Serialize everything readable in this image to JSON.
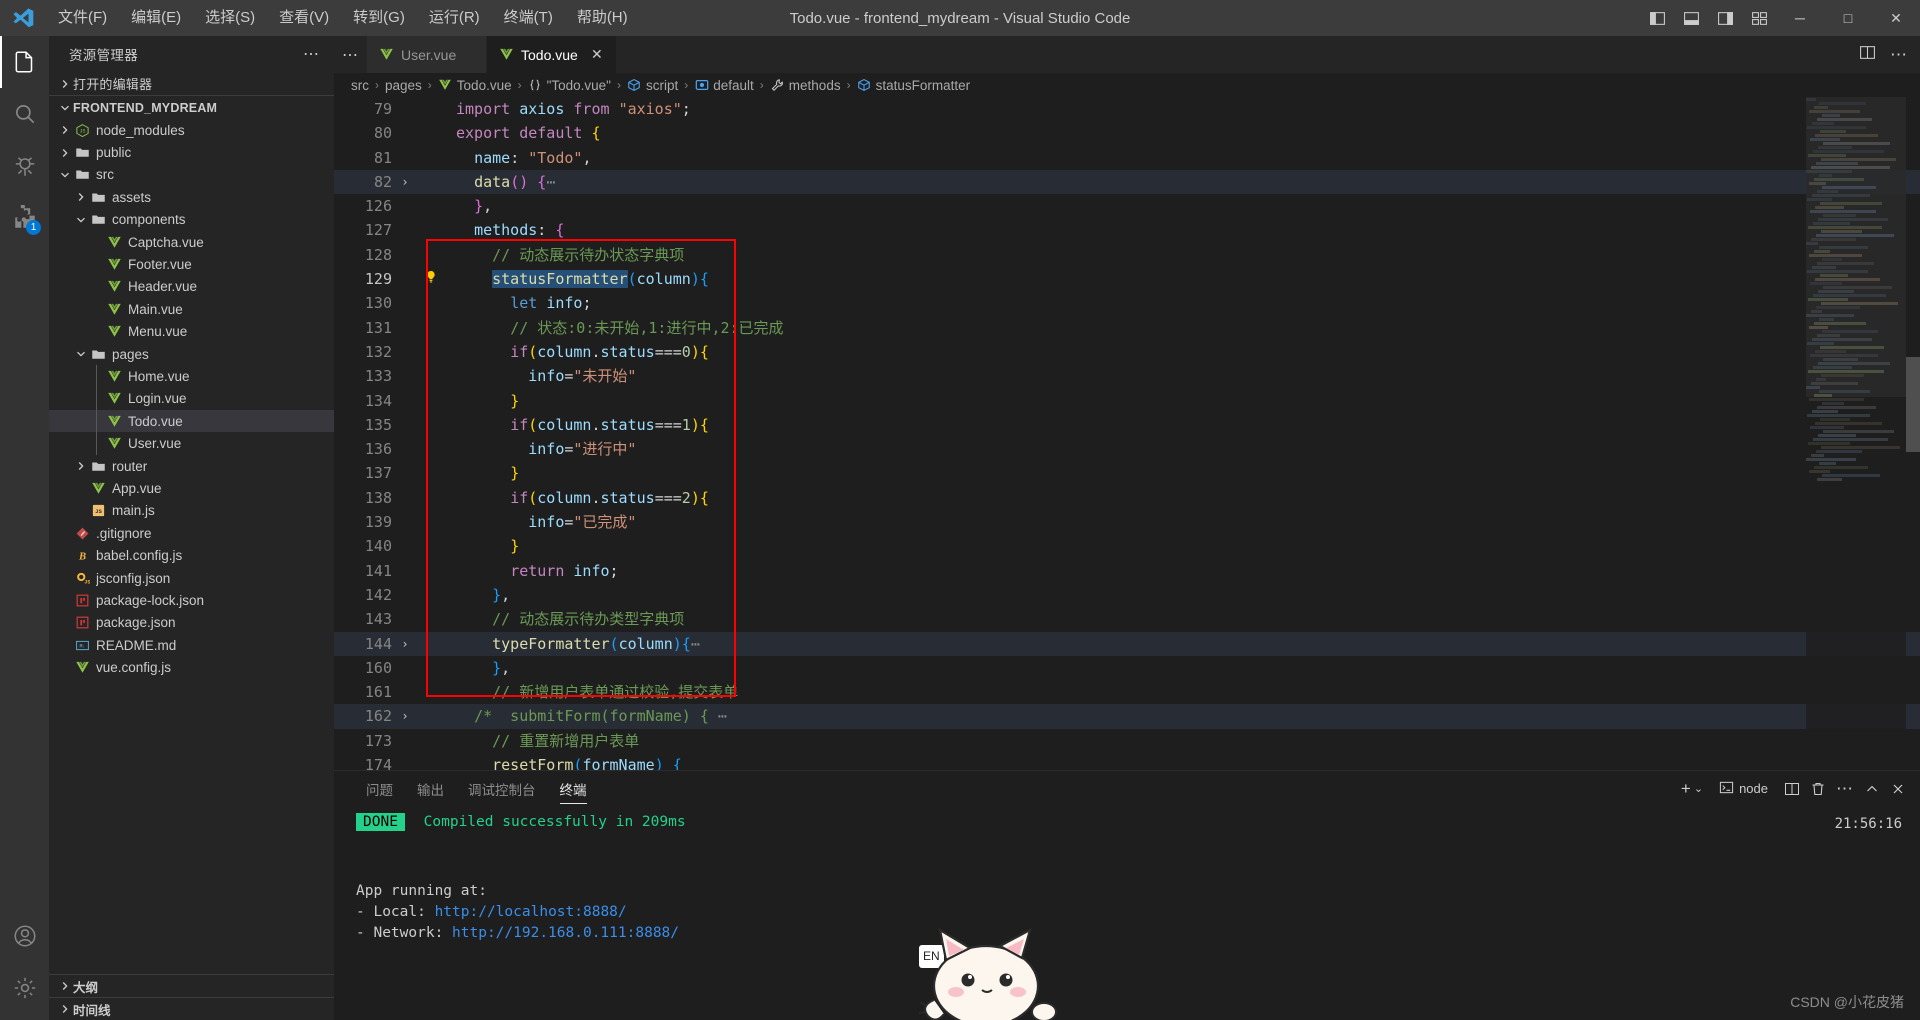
{
  "titlebar": {
    "logo_icon": "vscode-logo-icon",
    "menus": [
      "文件(F)",
      "编辑(E)",
      "选择(S)",
      "查看(V)",
      "转到(G)",
      "运行(R)",
      "终端(T)",
      "帮助(H)"
    ],
    "window_title": "Todo.vue - frontend_mydream - Visual Studio Code",
    "layout_buttons": [
      "toggle-primary-sidebar-icon",
      "toggle-panel-icon",
      "toggle-secondary-sidebar-icon",
      "customize-layout-icon"
    ],
    "minimize": "─",
    "maximize": "□",
    "close": "✕"
  },
  "activitybar": {
    "items": [
      {
        "name": "explorer",
        "icon": "files-icon",
        "active": true,
        "badge": ""
      },
      {
        "name": "search",
        "icon": "search-icon",
        "active": false,
        "badge": ""
      },
      {
        "name": "run-and-debug",
        "icon": "debug-icon",
        "active": false,
        "badge": ""
      },
      {
        "name": "extensions",
        "icon": "extensions-icon",
        "active": false,
        "badge": "1"
      }
    ],
    "bottom": [
      {
        "name": "accounts",
        "icon": "account-icon"
      },
      {
        "name": "manage",
        "icon": "gear-icon"
      }
    ]
  },
  "sidebar": {
    "title": "资源管理器",
    "more_actions": "⋯",
    "open_editors_label": "打开的编辑器",
    "project_label": "FRONTEND_MYDREAM",
    "tree": [
      {
        "label": "node_modules",
        "icon": "nodejs-icon",
        "depth": 1,
        "twisty": "collapsed",
        "selected": false
      },
      {
        "label": "public",
        "icon": "folder-icon",
        "depth": 1,
        "twisty": "collapsed",
        "selected": false
      },
      {
        "label": "src",
        "icon": "folder-icon",
        "depth": 1,
        "twisty": "expanded",
        "selected": false
      },
      {
        "label": "assets",
        "icon": "folder-icon",
        "depth": 2,
        "twisty": "collapsed",
        "selected": false
      },
      {
        "label": "components",
        "icon": "folder-icon",
        "depth": 2,
        "twisty": "expanded",
        "selected": false
      },
      {
        "label": "Captcha.vue",
        "icon": "vue-icon",
        "depth": 3,
        "twisty": "none",
        "selected": false
      },
      {
        "label": "Footer.vue",
        "icon": "vue-icon",
        "depth": 3,
        "twisty": "none",
        "selected": false
      },
      {
        "label": "Header.vue",
        "icon": "vue-icon",
        "depth": 3,
        "twisty": "none",
        "selected": false
      },
      {
        "label": "Main.vue",
        "icon": "vue-icon",
        "depth": 3,
        "twisty": "none",
        "selected": false
      },
      {
        "label": "Menu.vue",
        "icon": "vue-icon",
        "depth": 3,
        "twisty": "none",
        "selected": false
      },
      {
        "label": "pages",
        "icon": "folder-icon",
        "depth": 2,
        "twisty": "expanded",
        "selected": false
      },
      {
        "label": "Home.vue",
        "icon": "vue-icon",
        "depth": 3,
        "twisty": "none",
        "selected": false
      },
      {
        "label": "Login.vue",
        "icon": "vue-icon",
        "depth": 3,
        "twisty": "none",
        "selected": false
      },
      {
        "label": "Todo.vue",
        "icon": "vue-icon",
        "depth": 3,
        "twisty": "none",
        "selected": true
      },
      {
        "label": "User.vue",
        "icon": "vue-icon",
        "depth": 3,
        "twisty": "none",
        "selected": false
      },
      {
        "label": "router",
        "icon": "folder-icon",
        "depth": 2,
        "twisty": "collapsed",
        "selected": false
      },
      {
        "label": "App.vue",
        "icon": "vue-icon",
        "depth": 2,
        "twisty": "none",
        "selected": false
      },
      {
        "label": "main.js",
        "icon": "js-icon",
        "depth": 2,
        "twisty": "none",
        "selected": false
      },
      {
        "label": ".gitignore",
        "icon": "git-icon",
        "depth": 1,
        "twisty": "none",
        "selected": false
      },
      {
        "label": "babel.config.js",
        "icon": "babel-icon",
        "depth": 1,
        "twisty": "none",
        "selected": false
      },
      {
        "label": "jsconfig.json",
        "icon": "jsconfig-icon",
        "depth": 1,
        "twisty": "none",
        "selected": false
      },
      {
        "label": "package-lock.json",
        "icon": "npm-icon",
        "depth": 1,
        "twisty": "none",
        "selected": false
      },
      {
        "label": "package.json",
        "icon": "npm-icon",
        "depth": 1,
        "twisty": "none",
        "selected": false
      },
      {
        "label": "README.md",
        "icon": "markdown-icon",
        "depth": 1,
        "twisty": "none",
        "selected": false
      },
      {
        "label": "vue.config.js",
        "icon": "vue-icon",
        "depth": 1,
        "twisty": "none",
        "selected": false
      }
    ],
    "bottom_sections": [
      "大纲",
      "时间线"
    ]
  },
  "editor": {
    "tabs": [
      {
        "label": "User.vue",
        "icon": "vue-icon",
        "active": false,
        "closable": false
      },
      {
        "label": "Todo.vue",
        "icon": "vue-icon",
        "active": true,
        "closable": true
      }
    ],
    "tab_close": "✕",
    "tabs_overflow": "⋯",
    "actions": [
      "split-editor-icon",
      "more-actions-icon"
    ],
    "breadcrumb": [
      {
        "label": "src",
        "icon": ""
      },
      {
        "label": "pages",
        "icon": ""
      },
      {
        "label": "Todo.vue",
        "icon": "vue-icon"
      },
      {
        "label": "\"Todo.vue\"",
        "icon": "braces-icon"
      },
      {
        "label": "script",
        "icon": "module-icon"
      },
      {
        "label": "default",
        "icon": "object-icon"
      },
      {
        "label": "methods",
        "icon": "method-icon"
      },
      {
        "label": "statusFormatter",
        "icon": "module-icon"
      }
    ],
    "breadcrumb_sep": "›",
    "lines": [
      {
        "n": "79",
        "fold": "",
        "bulb": false,
        "hl": false,
        "html": "<span class=\"kw\">import</span> <span class=\"var\">axios</span> <span class=\"kw\">from</span> <span class=\"str\">\"axios\"</span><span class=\"punc\">;</span>"
      },
      {
        "n": "80",
        "fold": "",
        "bulb": false,
        "hl": false,
        "html": "<span class=\"kw\">export</span> <span class=\"kw\">default</span> <span class=\"br1\">{</span>"
      },
      {
        "n": "81",
        "fold": "",
        "bulb": false,
        "hl": false,
        "html": "  <span class=\"var\">name</span><span class=\"punc\">:</span> <span class=\"str\">\"Todo\"</span><span class=\"punc\">,</span>"
      },
      {
        "n": "82",
        "fold": "v",
        "bulb": false,
        "hl": true,
        "html": "  <span class=\"fn\">data</span><span class=\"br2\">()</span> <span class=\"br2\">{</span><span class=\"dots3\">⋯</span>"
      },
      {
        "n": "126",
        "fold": "",
        "bulb": false,
        "hl": false,
        "html": "  <span class=\"br2\">}</span><span class=\"punc\">,</span>"
      },
      {
        "n": "127",
        "fold": "",
        "bulb": false,
        "hl": false,
        "html": "  <span class=\"var\">methods</span><span class=\"punc\">:</span> <span class=\"br2\">{</span>"
      },
      {
        "n": "128",
        "fold": "",
        "bulb": false,
        "hl": false,
        "html": "    <span class=\"cmt\">// 动态展示待办状态字典项</span>"
      },
      {
        "n": "129",
        "fold": "",
        "bulb": true,
        "hl": false,
        "html": "    <span class=\"fn sel\">statusFormatter</span><span class=\"br3\">(</span><span class=\"var\">column</span><span class=\"br3\">)</span><span class=\"br3\">{</span>"
      },
      {
        "n": "130",
        "fold": "",
        "bulb": false,
        "hl": false,
        "html": "      <span class=\"kw2\">let</span> <span class=\"var\">info</span><span class=\"punc\">;</span>"
      },
      {
        "n": "131",
        "fold": "",
        "bulb": false,
        "hl": false,
        "html": "      <span class=\"cmt\">// 状态:0:未开始,1:进行中,2:已完成</span>"
      },
      {
        "n": "132",
        "fold": "",
        "bulb": false,
        "hl": false,
        "html": "      <span class=\"kw\">if</span><span class=\"br1\">(</span><span class=\"var\">column</span><span class=\"punc\">.</span><span class=\"var\">status</span><span class=\"punc\">===</span><span class=\"num\">0</span><span class=\"br1\">)</span><span class=\"br1\">{</span>"
      },
      {
        "n": "133",
        "fold": "",
        "bulb": false,
        "hl": false,
        "html": "        <span class=\"var\">info</span><span class=\"punc\">=</span><span class=\"str\">\"未开始\"</span>"
      },
      {
        "n": "134",
        "fold": "",
        "bulb": false,
        "hl": false,
        "html": "      <span class=\"br1\">}</span>"
      },
      {
        "n": "135",
        "fold": "",
        "bulb": false,
        "hl": false,
        "html": "      <span class=\"kw\">if</span><span class=\"br1\">(</span><span class=\"var\">column</span><span class=\"punc\">.</span><span class=\"var\">status</span><span class=\"punc\">===</span><span class=\"num\">1</span><span class=\"br1\">)</span><span class=\"br1\">{</span>"
      },
      {
        "n": "136",
        "fold": "",
        "bulb": false,
        "hl": false,
        "html": "        <span class=\"var\">info</span><span class=\"punc\">=</span><span class=\"str\">\"进行中\"</span>"
      },
      {
        "n": "137",
        "fold": "",
        "bulb": false,
        "hl": false,
        "html": "      <span class=\"br1\">}</span>"
      },
      {
        "n": "138",
        "fold": "",
        "bulb": false,
        "hl": false,
        "html": "      <span class=\"kw\">if</span><span class=\"br1\">(</span><span class=\"var\">column</span><span class=\"punc\">.</span><span class=\"var\">status</span><span class=\"punc\">===</span><span class=\"num\">2</span><span class=\"br1\">)</span><span class=\"br1\">{</span>"
      },
      {
        "n": "139",
        "fold": "",
        "bulb": false,
        "hl": false,
        "html": "        <span class=\"var\">info</span><span class=\"punc\">=</span><span class=\"str\">\"已完成\"</span>"
      },
      {
        "n": "140",
        "fold": "",
        "bulb": false,
        "hl": false,
        "html": "      <span class=\"br1\">}</span>"
      },
      {
        "n": "141",
        "fold": "",
        "bulb": false,
        "hl": false,
        "html": "      <span class=\"kw\">return</span> <span class=\"var\">info</span><span class=\"punc\">;</span>"
      },
      {
        "n": "142",
        "fold": "",
        "bulb": false,
        "hl": false,
        "html": "    <span class=\"br3\">}</span><span class=\"punc\">,</span>"
      },
      {
        "n": "143",
        "fold": "",
        "bulb": false,
        "hl": false,
        "html": "    <span class=\"cmt\">// 动态展示待办类型字典项</span>"
      },
      {
        "n": "144",
        "fold": "v",
        "bulb": false,
        "hl": true,
        "html": "    <span class=\"fn\">typeFormatter</span><span class=\"br3\">(</span><span class=\"var\">column</span><span class=\"br3\">)</span><span class=\"br3\">{</span><span class=\"dots3\">⋯</span>"
      },
      {
        "n": "160",
        "fold": "",
        "bulb": false,
        "hl": false,
        "html": "    <span class=\"br3\">}</span><span class=\"punc\">,</span>"
      },
      {
        "n": "161",
        "fold": "",
        "bulb": false,
        "hl": false,
        "html": "    <span class=\"cmt\">// 新增用户表单通过校验,提交表单</span>"
      },
      {
        "n": "162",
        "fold": "v",
        "bulb": false,
        "hl": true,
        "html": "  <span class=\"cmt\">/*  submitForm(formName) {</span> <span class=\"dots3\">⋯</span>"
      },
      {
        "n": "173",
        "fold": "",
        "bulb": false,
        "hl": false,
        "html": "    <span class=\"cmt\">// 重置新增用户表单</span>"
      },
      {
        "n": "174",
        "fold": "",
        "bulb": false,
        "hl": false,
        "html": "    <span class=\"fn\">resetForm</span><span class=\"br3\">(</span><span class=\"var\">formName</span><span class=\"br3\">)</span> <span class=\"br3\">{</span>"
      }
    ],
    "highlight_box_color": "#ff0000"
  },
  "panel": {
    "tabs": [
      {
        "label": "问题",
        "active": false
      },
      {
        "label": "输出",
        "active": false
      },
      {
        "label": "调试控制台",
        "active": false
      },
      {
        "label": "终端",
        "active": true
      }
    ],
    "actions": {
      "new_terminal": "+",
      "chevron": "⌄",
      "terminal_name": "node",
      "split_icon": "split-terminal-icon",
      "kill_icon": "trash-icon",
      "more_icon": "more-actions-icon",
      "chevron_up_icon": "chevron-up-icon",
      "close_icon": "close-icon"
    },
    "terminal": {
      "done_badge": "DONE",
      "compiled_line": "Compiled successfully in 209ms",
      "app_running": "  App running at:",
      "local_label": "  - Local:   ",
      "local_url": "http://localhost:8888/",
      "network_label": "  - Network: ",
      "network_url": "http://192.168.0.111:8888/",
      "clock": "21:56:16",
      "ime_indicator": "EN"
    }
  },
  "watermark": "CSDN @小花皮猪"
}
